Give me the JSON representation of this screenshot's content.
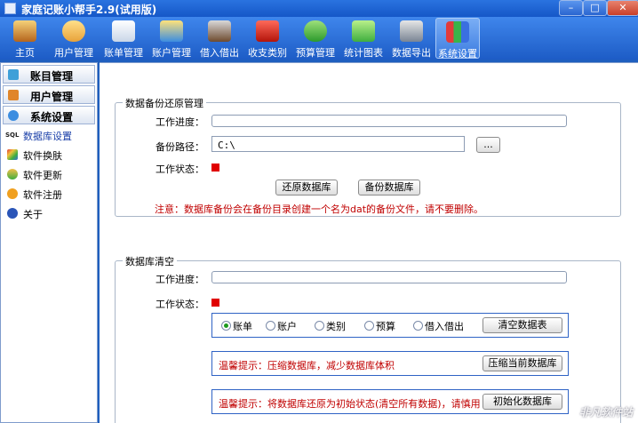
{
  "window": {
    "title": "家庭记账小帮手2.9(试用版)",
    "minimize": "–",
    "maximize": "□",
    "close": "✕"
  },
  "toolbar": {
    "items": [
      {
        "label": "主页",
        "icon": "house-icon"
      },
      {
        "label": "用户管理",
        "icon": "user-icon"
      },
      {
        "label": "账单管理",
        "icon": "bill-icon"
      },
      {
        "label": "账户管理",
        "icon": "account-icon"
      },
      {
        "label": "借入借出",
        "icon": "lend-icon"
      },
      {
        "label": "收支类别",
        "icon": "basket-icon"
      },
      {
        "label": "预算管理",
        "icon": "money-icon"
      },
      {
        "label": "统计图表",
        "icon": "chart-icon"
      },
      {
        "label": "数据导出",
        "icon": "export-icon"
      },
      {
        "label": "系统设置",
        "icon": "blocks-icon"
      }
    ],
    "active": "系统设置"
  },
  "sidebar": {
    "headers": [
      {
        "label": "账目管理"
      },
      {
        "label": "用户管理"
      },
      {
        "label": "系统设置"
      }
    ],
    "items": [
      {
        "label": "数据库设置",
        "icon": "sql-icon",
        "badge": "SQL"
      },
      {
        "label": "软件换肤",
        "icon": "palette-icon"
      },
      {
        "label": "软件更新",
        "icon": "globe-icon"
      },
      {
        "label": "软件注册",
        "icon": "key-icon"
      },
      {
        "label": "关于",
        "icon": "info-icon"
      }
    ]
  },
  "backup": {
    "title": "数据备份还原管理",
    "progress_label": "工作进度：",
    "path_label": "备份路径：",
    "path_value": "C:\\",
    "browse": "...",
    "status_label": "工作状态：",
    "restore_btn": "还原数据库",
    "backup_btn": "备份数据库",
    "note": "注意：数据库备份会在备份目录创建一个名为dat的备份文件，请不要删除。"
  },
  "clear": {
    "title": "数据库清空",
    "progress_label": "工作进度：",
    "status_label": "工作状态：",
    "options": [
      "账单",
      "账户",
      "类别",
      "预算",
      "借入借出"
    ],
    "selected": "账单",
    "clear_btn": "清空数据表",
    "compress_hint": "温馨提示：压缩数据库，减少数据库体积",
    "compress_btn": "压缩当前数据库",
    "init_hint": "温馨提示：将数据库还原为初始状态(清空所有数据)，请慎用",
    "init_btn": "初始化数据库"
  },
  "watermark": "非凡软件站"
}
